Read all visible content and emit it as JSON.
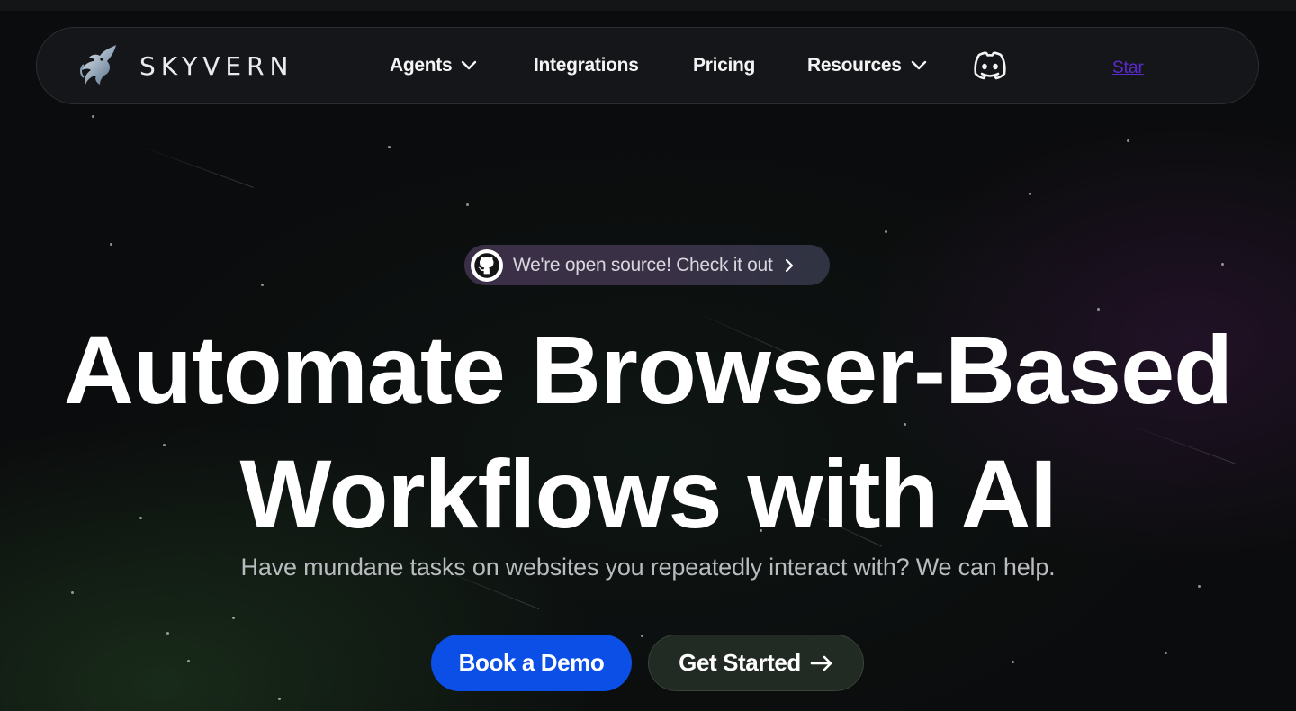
{
  "brand": {
    "name": "SKYVERN"
  },
  "nav": {
    "items": [
      {
        "label": "Agents",
        "has_dropdown": true
      },
      {
        "label": "Integrations",
        "has_dropdown": false
      },
      {
        "label": "Pricing",
        "has_dropdown": false
      },
      {
        "label": "Resources",
        "has_dropdown": true
      }
    ],
    "discord_icon": "discord-icon",
    "star_link": "Star"
  },
  "hero": {
    "badge_text": "We're open source! Check it out",
    "badge_icon": "github-icon",
    "title_line1": "Automate Browser-Based",
    "title_line2": "Workflows with AI",
    "subtitle": "Have mundane tasks on websites you repeatedly interact with? We can help.",
    "primary_button": "Book a Demo",
    "secondary_button": "Get Started"
  },
  "colors": {
    "background": "#0b0c0d",
    "navbar": "#151619",
    "primary_button": "#0b4fe6",
    "secondary_button": "#222a24",
    "star_link": "#5b2bd0"
  }
}
